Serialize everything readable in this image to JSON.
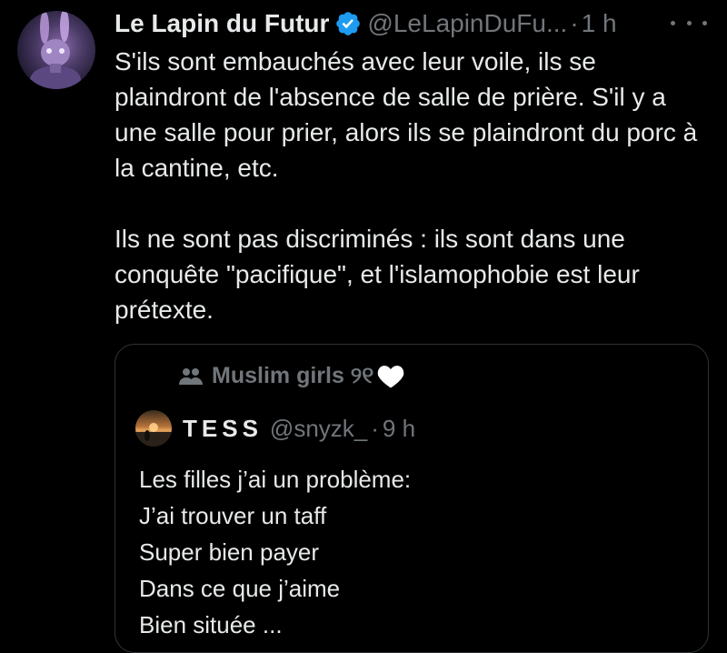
{
  "tweet": {
    "display_name": "Le Lapin du Futur",
    "handle": "@LeLapinDuFu...",
    "separator": "·",
    "time": "1 h",
    "verified_icon": "verified-badge-icon",
    "more_icon": "more-options-icon",
    "paragraphs": [
      "S'ils sont embauchés avec leur voile, ils se plaindront de l'absence de salle de prière. S'il y a une salle pour prier, alors ils se plaindront du porc à la cantine, etc.",
      "Ils ne sont pas discriminés : ils sont dans une conquête \"pacifique\", et l'islamophobie est leur prétexte."
    ]
  },
  "quote": {
    "community_icon": "community-people-icon",
    "community_name": "Muslim girls ୨୧",
    "community_emoji": "white-heart-icon",
    "author_name": "TESS",
    "author_handle": "@snyzk_",
    "separator": "·",
    "time": "9 h",
    "lines": [
      "Les filles j’ai un problème:",
      "J’ai trouver un taff",
      "Super bien payer",
      "Dans ce que j’aime",
      "Bien située ..."
    ]
  },
  "colors": {
    "background": "#000000",
    "text_primary": "#e7e9ea",
    "text_secondary": "#71767b",
    "verified_blue": "#1d9bf0",
    "border": "#2f3336"
  }
}
